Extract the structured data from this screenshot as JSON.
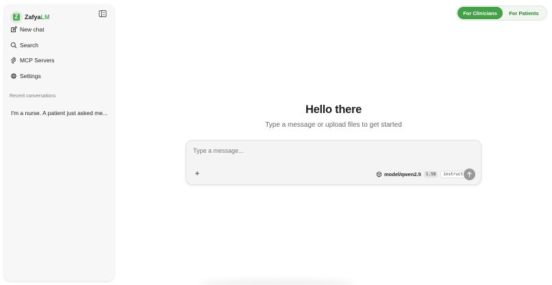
{
  "brand": {
    "name_prefix": "Zafya",
    "name_accent": "LM",
    "badge_letter": "Z",
    "accent_color": "#4caf50"
  },
  "sidebar": {
    "items": [
      {
        "label": "New chat",
        "icon": "edit-icon"
      },
      {
        "label": "Search",
        "icon": "search-icon"
      },
      {
        "label": "MCP Servers",
        "icon": "mcp-icon"
      },
      {
        "label": "Settings",
        "icon": "gear-icon"
      }
    ],
    "recent_label": "Recent conversations",
    "conversations": [
      {
        "title": "I'm a nurse. A patient just asked me..."
      }
    ]
  },
  "mode_toggle": {
    "clinicians": "For Clinicians",
    "patients": "For Patients",
    "active": "clinicians"
  },
  "main": {
    "greeting": "Hello there",
    "subtitle": "Type a message or upload files to get started"
  },
  "composer": {
    "placeholder": "Type a message...",
    "value": "",
    "model_name": "model/qwen2.5",
    "model_size": "1.5B",
    "model_variant": "instruct"
  }
}
